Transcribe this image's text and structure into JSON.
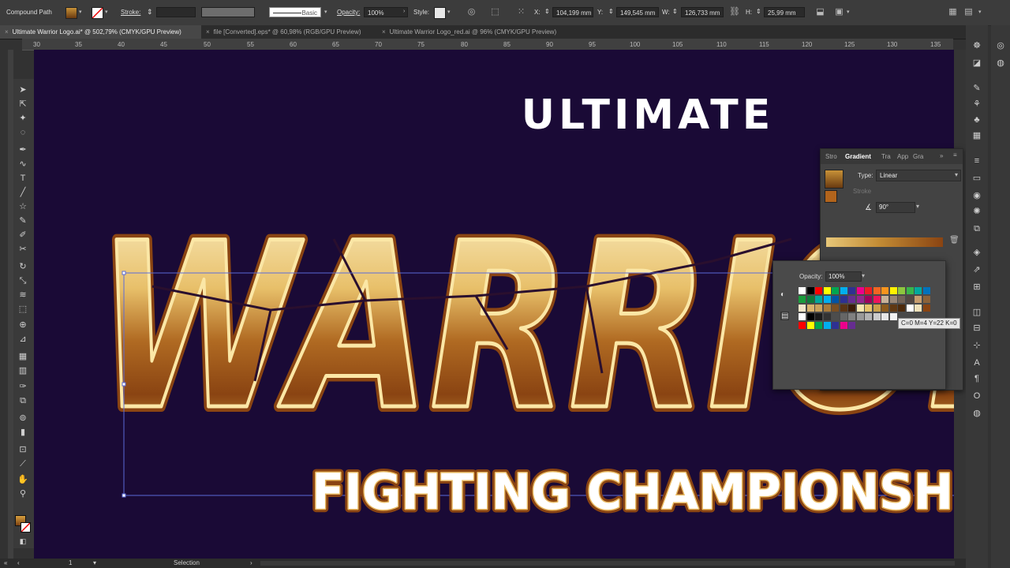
{
  "control_bar": {
    "object_type": "Compound Path",
    "stroke_label": "Stroke:",
    "brush_label": "Basic",
    "opacity_label": "Opacity:",
    "opacity_value": "100%",
    "style_label": "Style:",
    "x_label": "X:",
    "x_value": "104,199 mm",
    "y_label": "Y:",
    "y_value": "149,545 mm",
    "w_label": "W:",
    "w_value": "126,733 mm",
    "h_label": "H:",
    "h_value": "25,99 mm",
    "fill_color": "#a8741e"
  },
  "tabs": [
    {
      "label": "Ultimate Warrior Logo.ai* @ 502,79% (CMYK/GPU Preview)",
      "active": true
    },
    {
      "label": "file [Converted].eps* @ 60,98% (RGB/GPU Preview)",
      "active": false
    },
    {
      "label": "Ultimate Warrior Logo_red.ai @ 96% (CMYK/GPU Preview)",
      "active": false
    }
  ],
  "ruler_ticks": [
    "30",
    "35",
    "40",
    "45",
    "50",
    "55",
    "60",
    "65",
    "70",
    "75",
    "80",
    "85",
    "90",
    "95",
    "100",
    "105",
    "110",
    "115",
    "120",
    "125",
    "130",
    "135"
  ],
  "artwork": {
    "line1": "ULTIMATE",
    "line2": "WARRIOR",
    "line3": "FIGHTING CHAMPIONSHIP",
    "background": "#1a0a36",
    "gold_light": "#fbf0c8",
    "gold_mid": "#e2b44a",
    "gold_dark": "#8a4412"
  },
  "gradient_panel": {
    "tabs": [
      "Stro",
      "Gradient",
      "Tra",
      "App",
      "Gra"
    ],
    "type_label": "Type:",
    "type_value": "Linear",
    "stroke_label": "Stroke",
    "angle_value": "90°",
    "opacity_label": "Opacity:",
    "opacity_value": "100%"
  },
  "swatch_tooltip": "C=0 M=4 Y=22 K=0",
  "status": {
    "zoom": "1",
    "tool": "Selection"
  }
}
